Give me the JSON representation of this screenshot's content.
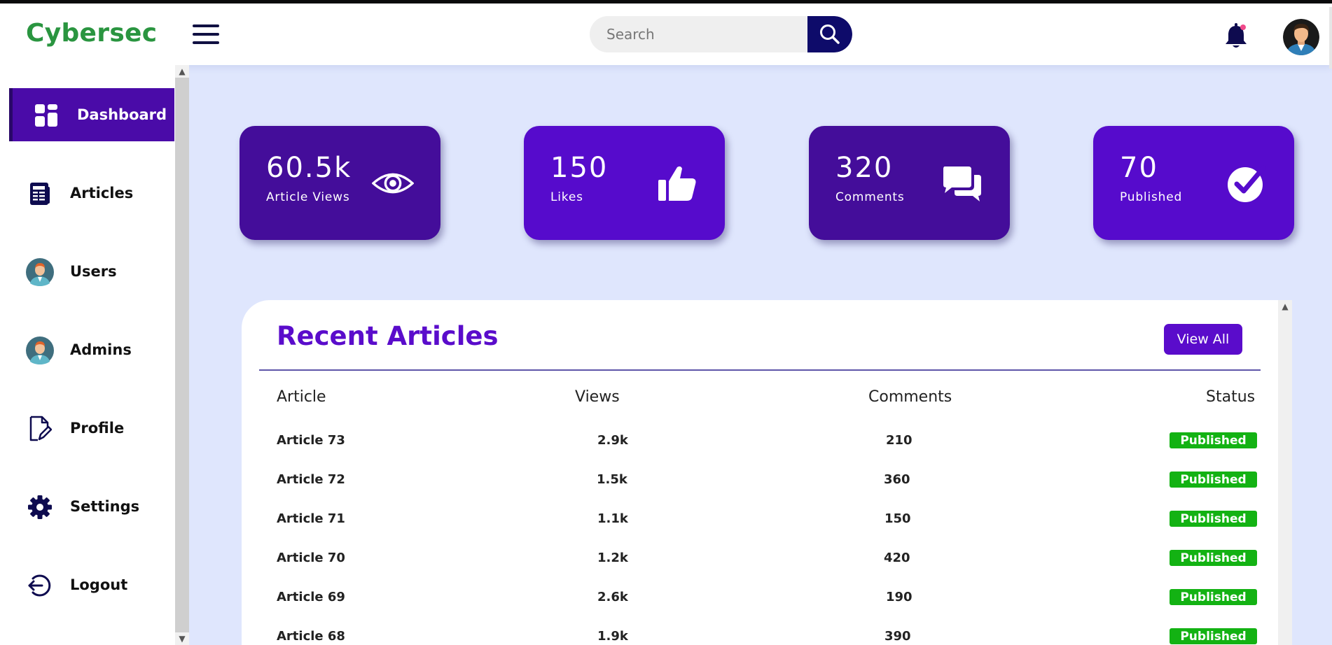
{
  "app": {
    "logo": "Cybersec"
  },
  "header": {
    "search_placeholder": "Search"
  },
  "sidebar": {
    "items": [
      {
        "label": "Dashboard",
        "icon": "dashboard-icon",
        "active": true
      },
      {
        "label": "Articles",
        "icon": "articles-icon"
      },
      {
        "label": "Users",
        "icon": "user-avatar-icon"
      },
      {
        "label": "Admins",
        "icon": "admin-avatar-icon"
      },
      {
        "label": "Profile",
        "icon": "profile-document-icon"
      },
      {
        "label": "Settings",
        "icon": "gear-icon"
      },
      {
        "label": "Logout",
        "icon": "logout-icon"
      }
    ]
  },
  "stats": [
    {
      "value": "60.5k",
      "label": "Article Views",
      "icon": "eye-icon"
    },
    {
      "value": "150",
      "label": "Likes",
      "icon": "thumbs-up-icon"
    },
    {
      "value": "320",
      "label": "Comments",
      "icon": "comments-icon"
    },
    {
      "value": "70",
      "label": "Published",
      "icon": "check-circle-icon"
    }
  ],
  "recent": {
    "title": "Recent Articles",
    "view_all": "View All",
    "columns": [
      "Article",
      "Views",
      "Comments",
      "Status"
    ],
    "rows": [
      {
        "article": "Article 73",
        "views": "2.9k",
        "comments": "210",
        "status": "Published"
      },
      {
        "article": "Article 72",
        "views": "1.5k",
        "comments": "360",
        "status": "Published"
      },
      {
        "article": "Article 71",
        "views": "1.1k",
        "comments": "150",
        "status": "Published"
      },
      {
        "article": "Article 70",
        "views": "1.2k",
        "comments": "420",
        "status": "Published"
      },
      {
        "article": "Article 69",
        "views": "2.6k",
        "comments": "190",
        "status": "Published"
      },
      {
        "article": "Article 68",
        "views": "1.9k",
        "comments": "390",
        "status": "Published"
      }
    ]
  },
  "colors": {
    "brand_green": "#2a9540",
    "accent_purple": "#5a0ccb",
    "card_dark": "#440d9a",
    "card_bright": "#560bcc",
    "published_green": "#13b213",
    "background": "#dfe6fd"
  }
}
